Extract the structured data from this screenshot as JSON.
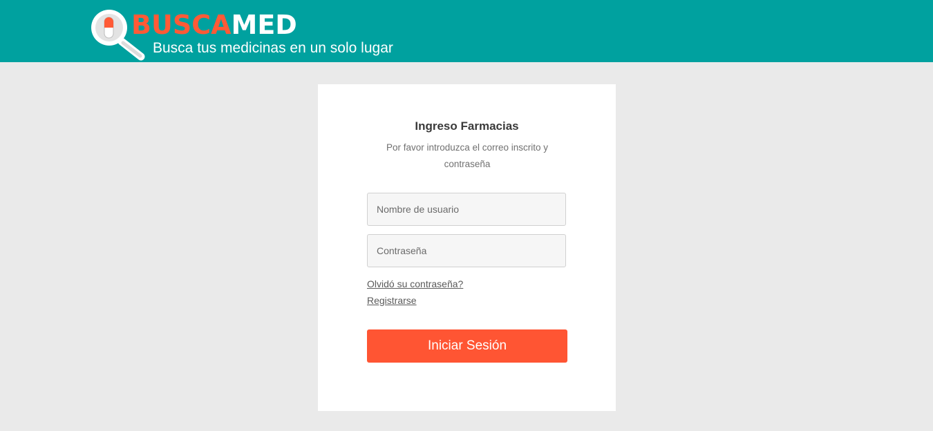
{
  "header": {
    "logo": {
      "word_part1": "BUSCA",
      "word_part2": "MED",
      "tagline": "Busca tus medicinas en un solo lugar"
    }
  },
  "login": {
    "title": "Ingreso Farmacias",
    "subtitle": "Por favor introduzca el correo inscrito y contraseña",
    "username_placeholder": "Nombre de usuario",
    "password_placeholder": "Contraseña",
    "forgot_link": "Olvidó su contraseña?",
    "register_link": "Registrarse",
    "submit_label": "Iniciar Sesión"
  },
  "colors": {
    "header_bg": "#00a19f",
    "page_bg": "#eaeaea",
    "accent": "#ff5533",
    "card_bg": "#ffffff"
  }
}
